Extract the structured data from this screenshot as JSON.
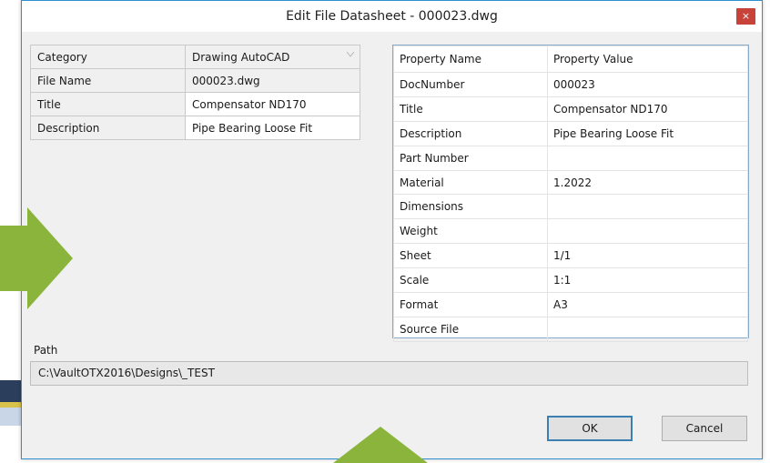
{
  "window": {
    "title": "Edit File Datasheet - 000023.dwg",
    "close_glyph": "×"
  },
  "left_grid": [
    {
      "key": "Category",
      "value": "Drawing AutoCAD"
    },
    {
      "key": "File Name",
      "value": "000023.dwg"
    },
    {
      "key": "Title",
      "value": "Compensator ND170"
    },
    {
      "key": "Description",
      "value": "Pipe Bearing Loose Fit"
    }
  ],
  "right_grid": {
    "header": {
      "name": "Property Name",
      "value": "Property Value"
    },
    "rows": [
      {
        "name": "DocNumber",
        "value": "000023"
      },
      {
        "name": "Title",
        "value": "Compensator ND170"
      },
      {
        "name": "Description",
        "value": "Pipe Bearing Loose Fit"
      },
      {
        "name": "Part Number",
        "value": ""
      },
      {
        "name": "Material",
        "value": "1.2022"
      },
      {
        "name": "Dimensions",
        "value": ""
      },
      {
        "name": "Weight",
        "value": ""
      },
      {
        "name": "Sheet",
        "value": "1/1"
      },
      {
        "name": "Scale",
        "value": "1:1"
      },
      {
        "name": "Format",
        "value": "A3"
      },
      {
        "name": "Source File",
        "value": ""
      }
    ]
  },
  "path": {
    "label": "Path",
    "value": "C:\\VaultOTX2016\\Designs\\_TEST"
  },
  "buttons": {
    "ok": "OK",
    "cancel": "Cancel"
  },
  "colors": {
    "accent_border": "#2f8fcf",
    "close_button": "#c7433a",
    "overlay_arrow": "#8bb43c"
  }
}
